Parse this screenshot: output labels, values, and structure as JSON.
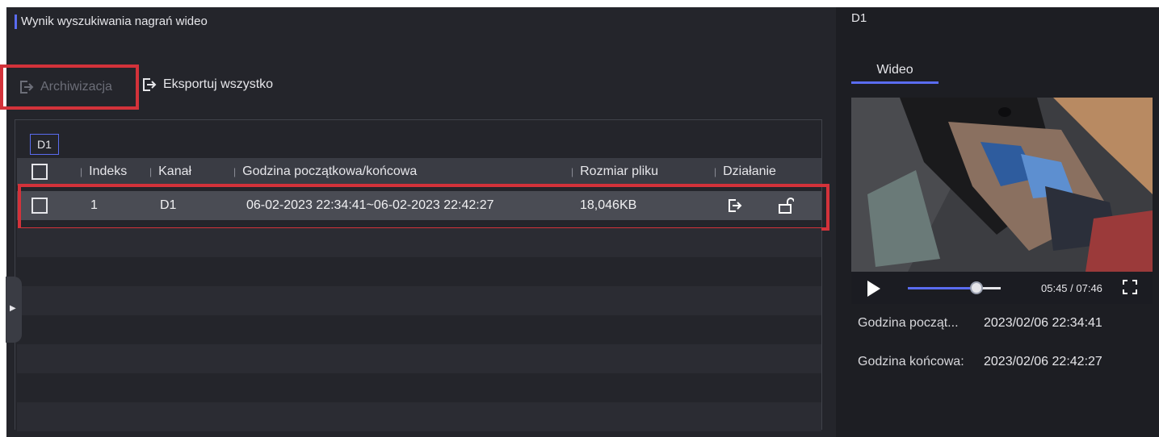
{
  "header": {
    "title": "Wynik wyszukiwania nagrań wideo"
  },
  "toolbar": {
    "archive_label": "Archiwizacja",
    "export_all_label": "Eksportuj wszystko"
  },
  "channel_tab": "D1",
  "table": {
    "columns": [
      "Indeks",
      "Kanał",
      "Godzina początkowa/końcowa",
      "Rozmiar pliku",
      "Działanie"
    ],
    "rows": [
      {
        "index": "1",
        "channel": "D1",
        "time_range": "06-02-2023 22:34:41~06-02-2023 22:42:27",
        "size": "18,046KB"
      }
    ]
  },
  "preview": {
    "channel": "D1",
    "tab": "Wideo",
    "time_display": "05:45 / 07:46",
    "progress": 0.74,
    "start_label": "Godzina począt...",
    "start_value": "2023/02/06 22:34:41",
    "end_label": "Godzina końcowa:",
    "end_value": "2023/02/06 22:42:27"
  },
  "colors": {
    "accent": "#5a6cf0",
    "highlight_box": "#d3323a",
    "panel": "#24252b"
  },
  "icons": [
    "export-icon",
    "lock-open-icon",
    "play-icon",
    "fullscreen-icon",
    "expand-handle-icon"
  ]
}
